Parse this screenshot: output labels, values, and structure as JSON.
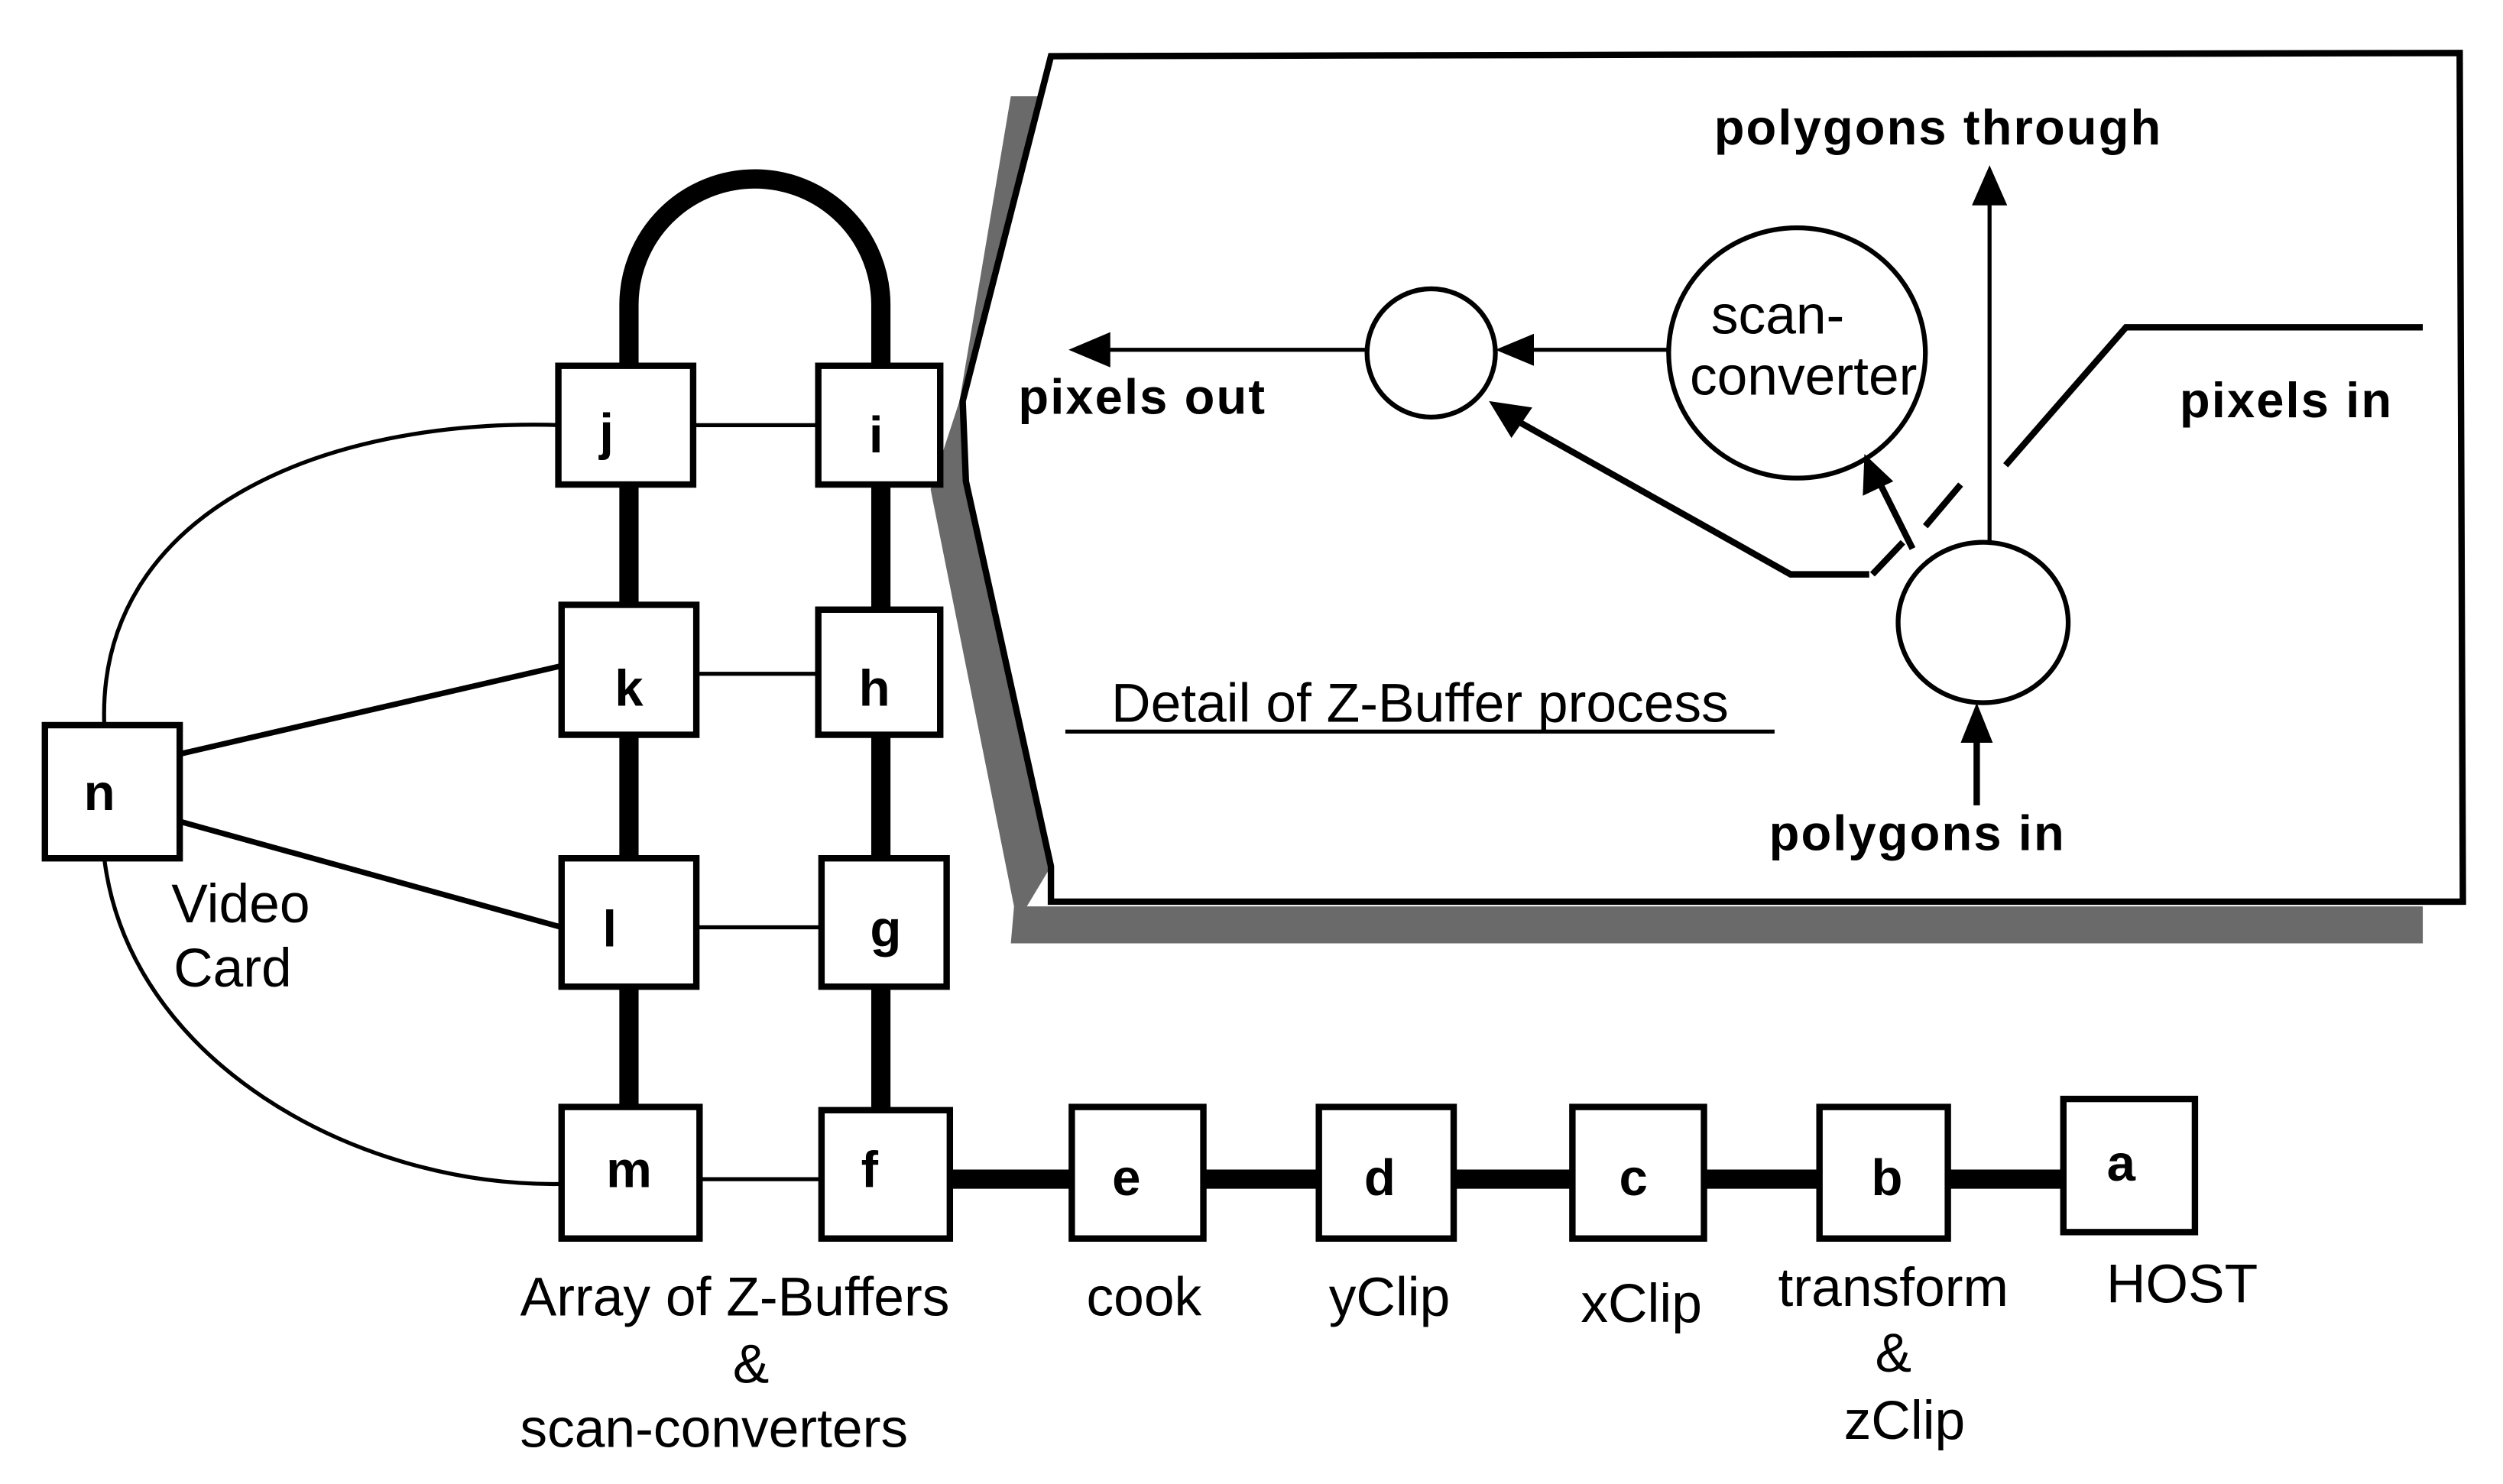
{
  "pipeline": {
    "nodes": [
      {
        "id": "a",
        "caption": "HOST"
      },
      {
        "id": "b",
        "caption": "transform",
        "caption2": "&",
        "caption3": "zClip"
      },
      {
        "id": "c",
        "caption": "xClip"
      },
      {
        "id": "d",
        "caption": "yClip"
      },
      {
        "id": "e",
        "caption": "cook"
      },
      {
        "id": "f"
      },
      {
        "id": "g"
      },
      {
        "id": "h"
      },
      {
        "id": "i"
      },
      {
        "id": "j"
      },
      {
        "id": "k"
      },
      {
        "id": "l"
      },
      {
        "id": "m"
      },
      {
        "id": "n",
        "caption": "Video",
        "caption2": "Card"
      }
    ],
    "array_caption": [
      "Array of Z-Buffers",
      "&",
      "scan-converters"
    ]
  },
  "detail": {
    "title": "Detail of Z-Buffer process",
    "polygons_through": "polygons  through",
    "polygons_in": "polygons  in",
    "pixels_in": "pixels  in",
    "pixels_out": "pixels  out",
    "scan_converter": [
      "scan-",
      "converter"
    ]
  }
}
